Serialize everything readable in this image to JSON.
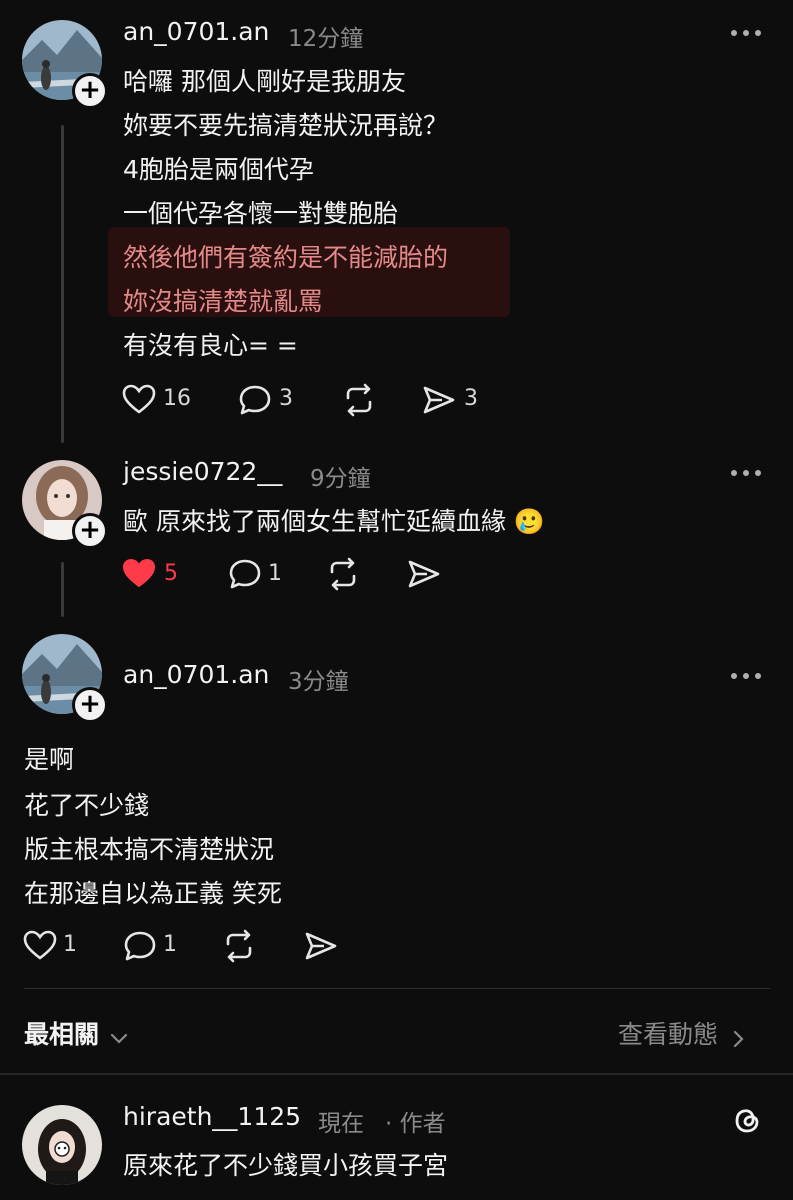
{
  "comments": [
    {
      "username": "an_0701.an",
      "time": "12分鐘",
      "lines": [
        "哈囉 那個人剛好是我朋友",
        "妳要不要先搞清楚狀況再說？",
        "4胞胎是兩個代孕",
        "一個代孕各懷一對雙胞胎",
        "然後他們有簽約是不能減胎的",
        "妳沒搞清楚就亂罵",
        "有沒有良心= ="
      ],
      "likes": "16",
      "replies": "3",
      "shares": "3"
    },
    {
      "username": "jessie0722__",
      "time": "9分鐘",
      "lines": [
        "歐 原來找了兩個女生幫忙延續血緣"
      ],
      "emoji": "🥲",
      "likes": "5",
      "replies": "1"
    },
    {
      "username": "an_0701.an",
      "time": "3分鐘",
      "lines": [
        "是啊",
        "花了不少錢",
        "版主根本搞不清楚狀況",
        "在那邊自以為正義 笑死"
      ],
      "likes": "1",
      "replies": "1"
    }
  ],
  "related": {
    "title": "最相關",
    "view_activity": "查看動態"
  },
  "footer_post": {
    "username": "hiraeth__1125",
    "time": "現在",
    "author_tag": "· 作者",
    "text": "原來花了不少錢買小孩買子宮"
  },
  "colors": {
    "background": "#0d0d0d",
    "like_active": "#ff3b4a",
    "highlight_text": "#e48989"
  }
}
